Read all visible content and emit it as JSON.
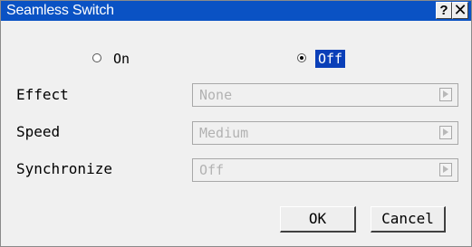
{
  "window": {
    "title": "Seamless Switch",
    "help_label": "?",
    "close_label": "✕"
  },
  "seamless_switch": {
    "on_label": "On",
    "off_label": "Off",
    "selected": "Off"
  },
  "fields": {
    "effect_label": "Effect",
    "effect_value": "None",
    "speed_label": "Speed",
    "speed_value": "Medium",
    "sync_label": "Synchronize",
    "sync_value": "Off"
  },
  "buttons": {
    "ok_label": "OK",
    "cancel_label": "Cancel"
  },
  "colors": {
    "titlebar": "#0a52c4",
    "selection_highlight": "#0a3fb8",
    "dialog_background": "#f0f0f0",
    "disabled_text": "#b2b2b2"
  },
  "icons": {
    "help": "question-mark-icon",
    "close": "close-icon",
    "dropdown": "triangle-right-icon",
    "radio": "radio-button-icon"
  }
}
